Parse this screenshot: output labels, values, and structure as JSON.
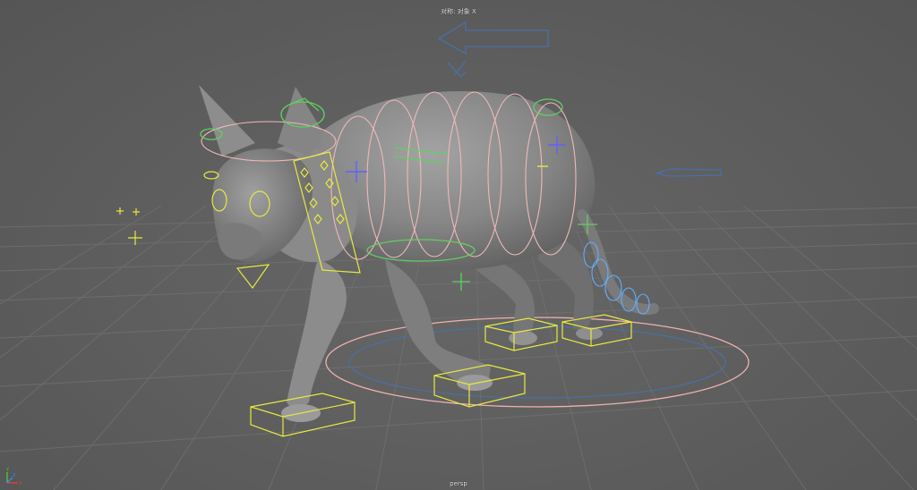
{
  "viewport": {
    "symmetry_label": "对称: 对象 X",
    "camera_label": "persp"
  },
  "axis_gizmo": {
    "x_label": "X",
    "y_label": "Y",
    "z_label": "Z",
    "x_color": "#e04040",
    "y_color": "#40d040",
    "z_color": "#4080ff"
  },
  "colors": {
    "background": "#5d5d5d",
    "grid_line": "#707070",
    "mesh": "#8a8a8a",
    "ik_control": "#e8e840",
    "fk_control": "#60d060",
    "spine_control": "#f0b8b8",
    "tail_control": "#60b0ff",
    "root_control": "#f0b0b0"
  }
}
